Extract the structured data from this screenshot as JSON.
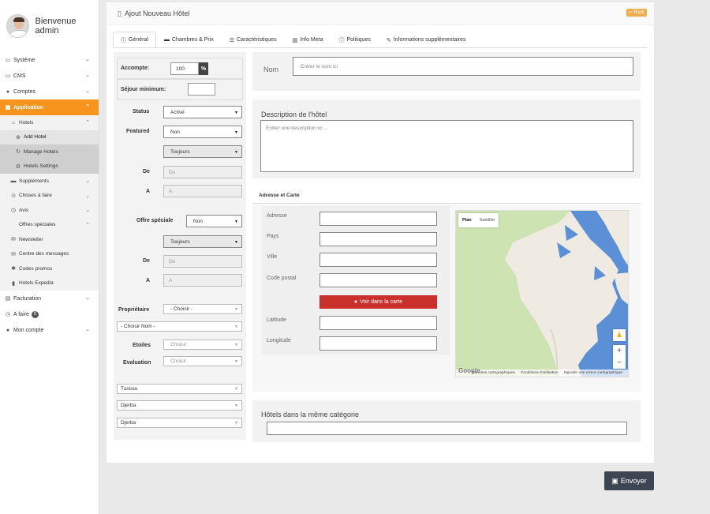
{
  "sidebar": {
    "greeting": "Bienvenue admin",
    "items": [
      {
        "icon": "monitor-icon",
        "glyph": "▭",
        "label": "Système"
      },
      {
        "icon": "cms-icon",
        "glyph": "▭",
        "label": "CMS"
      },
      {
        "icon": "user-icon",
        "glyph": "●",
        "label": "Comptes"
      },
      {
        "icon": "grid-icon",
        "glyph": "▦",
        "label": "Application"
      },
      {
        "icon": "home-icon",
        "glyph": "⌂",
        "label": "Hotels"
      },
      {
        "icon": "add-circle-icon",
        "glyph": "⊕",
        "label": "Add Hotel"
      },
      {
        "icon": "refresh-icon",
        "glyph": "↻",
        "label": "Manage Hotels"
      },
      {
        "icon": "settings-icon",
        "glyph": "⚙",
        "label": "Hotels Settings"
      },
      {
        "icon": "card-icon",
        "glyph": "▬",
        "label": "Suppléments"
      },
      {
        "icon": "check-circle-icon",
        "glyph": "⊙",
        "label": "Choses à faire"
      },
      {
        "icon": "clock-icon",
        "glyph": "◷",
        "label": "Avis"
      },
      {
        "icon": "",
        "glyph": "",
        "label": "Offres spéciales"
      },
      {
        "icon": "envelope-icon",
        "glyph": "✉",
        "label": "Newsletter"
      },
      {
        "icon": "envelope-icon",
        "glyph": "✉",
        "label": "Centre des messages"
      },
      {
        "icon": "star-icon",
        "glyph": "✱",
        "label": "Codes promos"
      },
      {
        "icon": "building-icon",
        "glyph": "▮",
        "label": "Hotels Expedia"
      },
      {
        "icon": "file-icon",
        "glyph": "▤",
        "label": "Facturation"
      },
      {
        "icon": "clock-icon",
        "glyph": "◷",
        "label": "A faire"
      },
      {
        "icon": "user-icon",
        "glyph": "●",
        "label": "Mon compte"
      }
    ],
    "todo_count": "0"
  },
  "header": {
    "title": "Ajout Nouveau Hôtel",
    "back_label": "Back"
  },
  "tabs": [
    {
      "icon": "info-icon",
      "glyph": "ⓘ",
      "label": "Général"
    },
    {
      "icon": "bed-icon",
      "glyph": "▬",
      "label": "Chambres & Prix"
    },
    {
      "icon": "list-icon",
      "glyph": "☰",
      "label": "Caractéristiques"
    },
    {
      "icon": "chart-icon",
      "glyph": "▥",
      "label": "Info Meta"
    },
    {
      "icon": "info-icon",
      "glyph": "ⓘ",
      "label": "Politiques"
    },
    {
      "icon": "wrench-icon",
      "glyph": "✎",
      "label": "Informations supplémentaires"
    }
  ],
  "left": {
    "deposit_label": "Accompte:",
    "deposit_value": "100",
    "deposit_unit": "%",
    "min_stay_label": "Séjour minimum:",
    "min_stay_value": "",
    "status_label": "Status",
    "status_value": "Activé",
    "featured_label": "Featured",
    "featured_value": "Non",
    "featured_period": "Toujours",
    "from_label": "De",
    "from_placeholder": "De",
    "to_label": "A",
    "to_placeholder": "A",
    "special_label": "Offre spéciale",
    "special_value": "Non",
    "special_period": "Toujours",
    "from2_label": "De",
    "from2_placeholder": "De",
    "to2_label": "A",
    "to2_placeholder": "A",
    "owner_label": "Propriétaire",
    "owner_value": "- Choisir -",
    "name_select": "- Choisir Nom -",
    "stars_label": "Etoiles",
    "stars_value": "Choisir",
    "rating_label": "Evaluation",
    "rating_value": "Choisir",
    "country": "Tunisia",
    "region": "Djerba",
    "city": "Djerba"
  },
  "right": {
    "name_label": "Nom",
    "name_placeholder": "Entrer le nom ici",
    "desc_title": "Description de l'hôtel",
    "desc_placeholder": "Entrer une description ici ...",
    "address_title": "Adresse et Carte",
    "address_label": "Adresse",
    "country_label": "Pays",
    "city_label": "Ville",
    "zip_label": "Code postal",
    "map_button": "Voir dans la carte",
    "lat_label": "Latitude",
    "lng_label": "Longitude",
    "related_title": "Hôtels dans la même catégorie"
  },
  "map": {
    "type_plan": "Plan",
    "type_satellite": "Satellite",
    "zoom_in": "+",
    "zoom_out": "−",
    "logo": "Google",
    "foot_data": "Données cartographiques",
    "foot_terms": "Conditions d'utilisation",
    "foot_report": "Signaler une erreur cartographique"
  },
  "submit_label": "Envoyer",
  "colors": {
    "accent": "#f7941d",
    "danger": "#c9302c",
    "dark": "#3e4552",
    "water": "#5b8fd6",
    "land_green": "#c9dfa7"
  }
}
